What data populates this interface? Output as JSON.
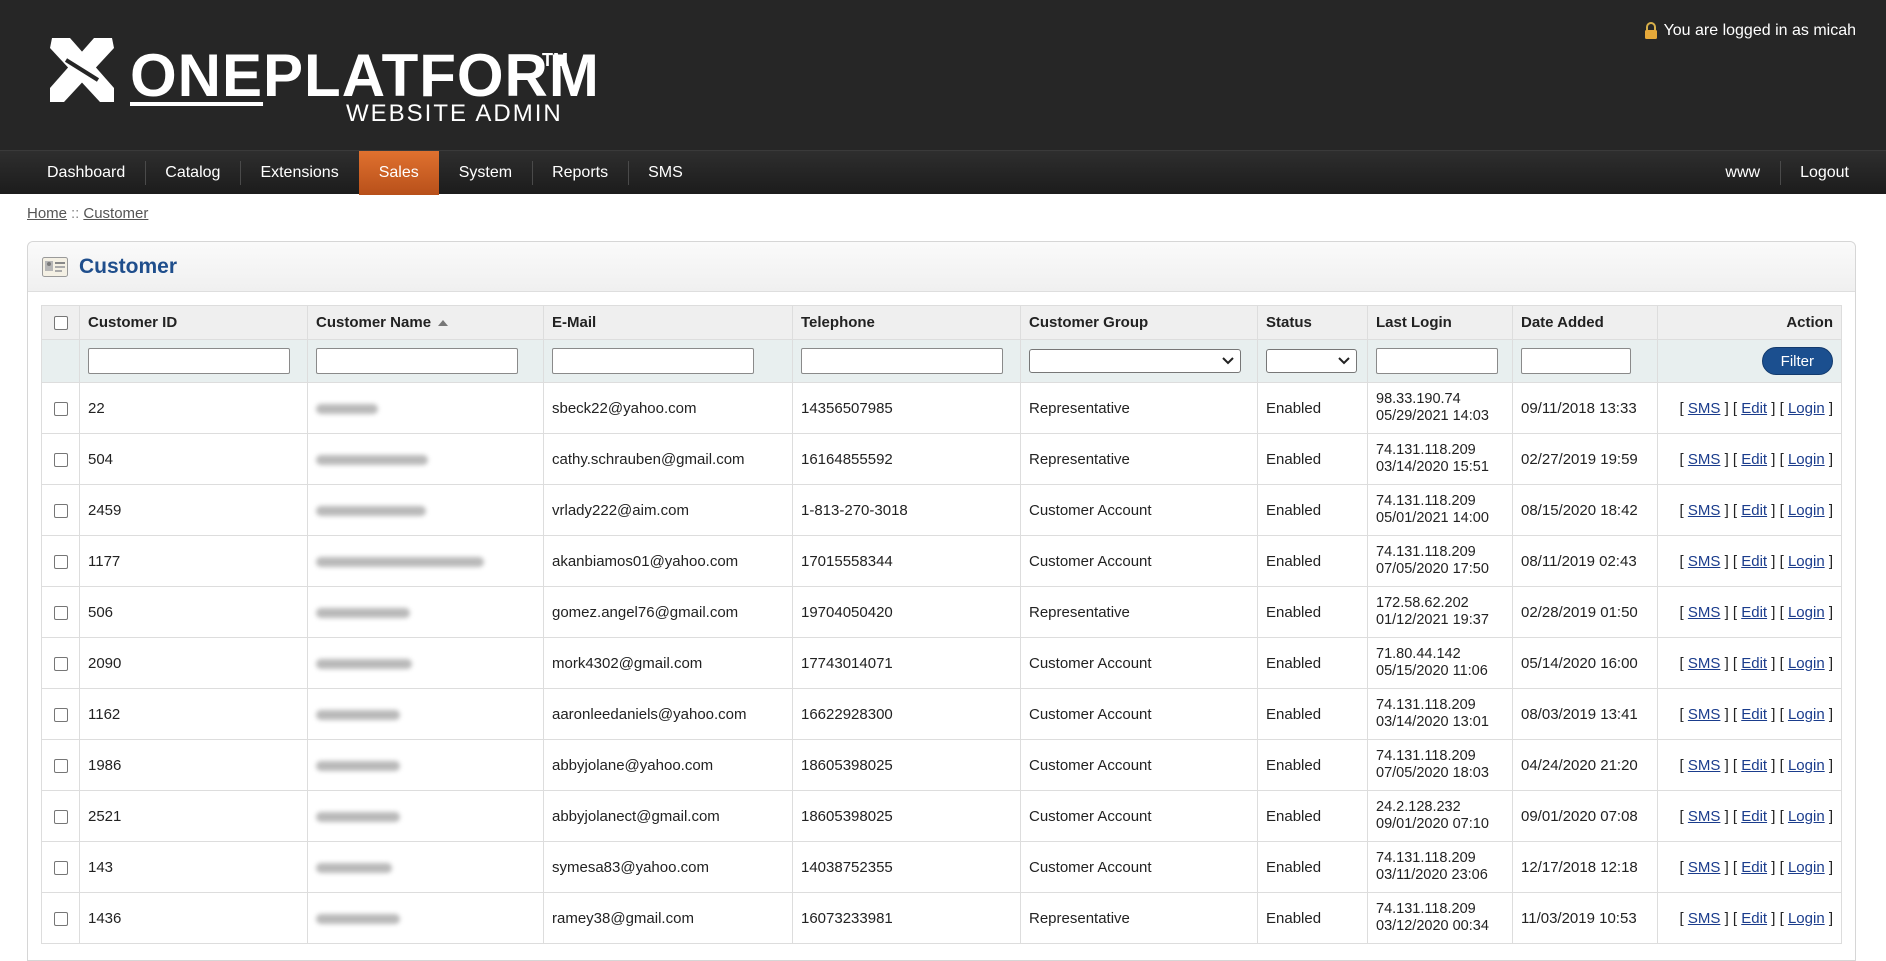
{
  "header": {
    "logo_one": "ONE",
    "logo_platform": "PLATFORM",
    "logo_tm": "TM",
    "logo_subtitle": "WEBSITE ADMIN",
    "login_text": "You are logged in as micah"
  },
  "nav": {
    "left": [
      "Dashboard",
      "Catalog",
      "Extensions",
      "Sales",
      "System",
      "Reports",
      "SMS"
    ],
    "active": "Sales",
    "right": [
      "www",
      "Logout"
    ]
  },
  "breadcrumb": {
    "home": "Home",
    "sep": "::",
    "current": "Customer"
  },
  "panel": {
    "title": "Customer"
  },
  "table": {
    "headers": {
      "id": "Customer ID",
      "name": "Customer Name",
      "email": "E-Mail",
      "phone": "Telephone",
      "group": "Customer Group",
      "status": "Status",
      "last_login": "Last Login",
      "date_added": "Date Added",
      "action": "Action"
    },
    "filter_button": "Filter",
    "action_labels": {
      "sms": "SMS",
      "edit": "Edit",
      "login": "Login"
    },
    "rows": [
      {
        "id": "22",
        "email": "sbeck22@yahoo.com",
        "phone": "14356507985",
        "group": "Representative",
        "status": "Enabled",
        "ip": "98.33.190.74",
        "login": "05/29/2021 14:03",
        "added": "09/11/2018 13:33"
      },
      {
        "id": "504",
        "email": "cathy.schrauben@gmail.com",
        "phone": "16164855592",
        "group": "Representative",
        "status": "Enabled",
        "ip": "74.131.118.209",
        "login": "03/14/2020 15:51",
        "added": "02/27/2019 19:59"
      },
      {
        "id": "2459",
        "email": "vrlady222@aim.com",
        "phone": "1-813-270-3018",
        "group": "Customer Account",
        "status": "Enabled",
        "ip": "74.131.118.209",
        "login": "05/01/2021 14:00",
        "added": "08/15/2020 18:42"
      },
      {
        "id": "1177",
        "email": "akanbiamos01@yahoo.com",
        "phone": "17015558344",
        "group": "Customer Account",
        "status": "Enabled",
        "ip": "74.131.118.209",
        "login": "07/05/2020 17:50",
        "added": "08/11/2019 02:43"
      },
      {
        "id": "506",
        "email": "gomez.angel76@gmail.com",
        "phone": "19704050420",
        "group": "Representative",
        "status": "Enabled",
        "ip": "172.58.62.202",
        "login": "01/12/2021 19:37",
        "added": "02/28/2019 01:50"
      },
      {
        "id": "2090",
        "email": "mork4302@gmail.com",
        "phone": "17743014071",
        "group": "Customer Account",
        "status": "Enabled",
        "ip": "71.80.44.142",
        "login": "05/15/2020 11:06",
        "added": "05/14/2020 16:00"
      },
      {
        "id": "1162",
        "email": "aaronleedaniels@yahoo.com",
        "phone": "16622928300",
        "group": "Customer Account",
        "status": "Enabled",
        "ip": "74.131.118.209",
        "login": "03/14/2020 13:01",
        "added": "08/03/2019 13:41"
      },
      {
        "id": "1986",
        "email": "abbyjolane@yahoo.com",
        "phone": "18605398025",
        "group": "Customer Account",
        "status": "Enabled",
        "ip": "74.131.118.209",
        "login": "07/05/2020 18:03",
        "added": "04/24/2020 21:20"
      },
      {
        "id": "2521",
        "email": "abbyjolanect@gmail.com",
        "phone": "18605398025",
        "group": "Customer Account",
        "status": "Enabled",
        "ip": "24.2.128.232",
        "login": "09/01/2020 07:10",
        "added": "09/01/2020 07:08"
      },
      {
        "id": "143",
        "email": "symesa83@yahoo.com",
        "phone": "14038752355",
        "group": "Customer Account",
        "status": "Enabled",
        "ip": "74.131.118.209",
        "login": "03/11/2020 23:06",
        "added": "12/17/2018 12:18"
      },
      {
        "id": "1436",
        "email": "ramey38@gmail.com",
        "phone": "16073233981",
        "group": "Representative",
        "status": "Enabled",
        "ip": "74.131.118.209",
        "login": "03/12/2020 00:34",
        "added": "11/03/2019 10:53"
      }
    ]
  },
  "colors": {
    "header_bg": "#262626",
    "nav_active": "#d2622a",
    "title": "#1f4e8c",
    "link": "#1a3c8c",
    "filter_btn": "#1b4f8f"
  }
}
